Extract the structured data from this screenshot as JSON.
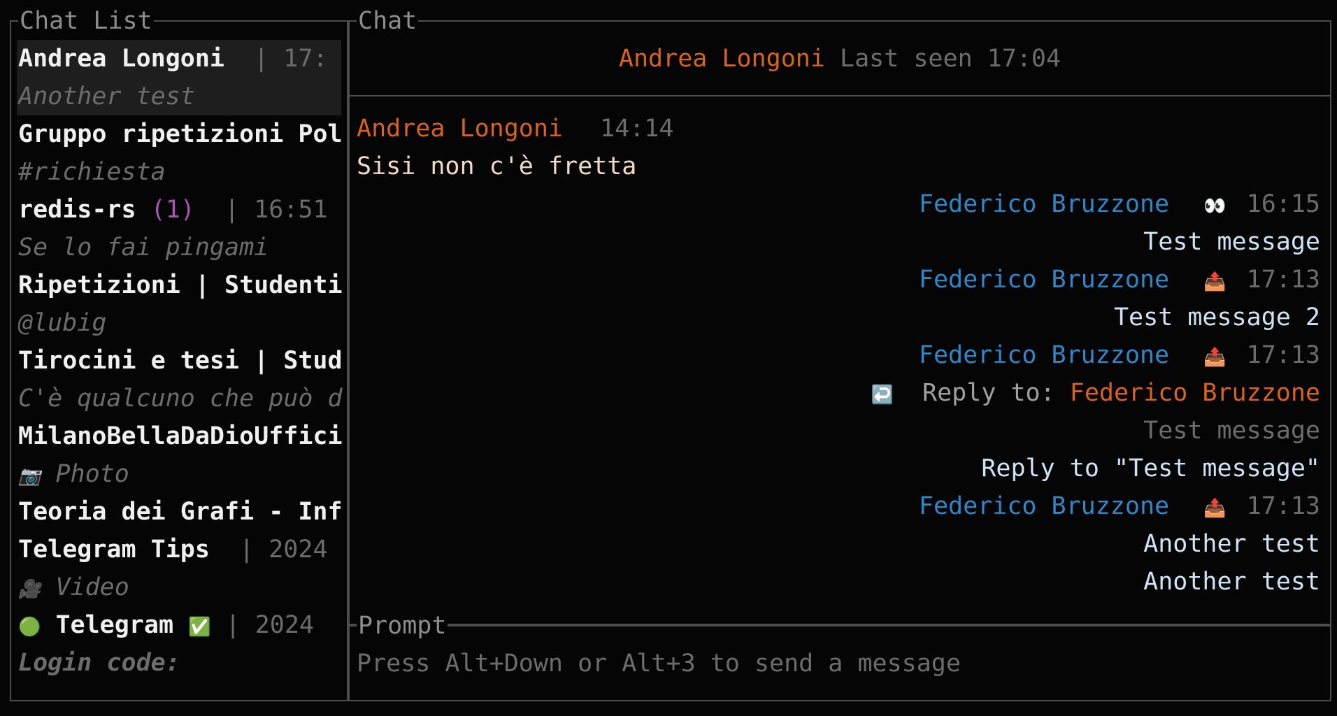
{
  "chat_list": {
    "title": "Chat List",
    "items": [
      {
        "name": "Andrea Longoni",
        "meta": "  | 17:",
        "preview": "Another test"
      },
      {
        "name": "Gruppo ripetizioni Pol",
        "preview": "#richiesta"
      },
      {
        "name": "redis-rs",
        "unread": "(1)",
        "meta": "  | 16:51",
        "preview": "Se lo fai pingami"
      },
      {
        "name": "Ripetizioni | Studenti",
        "preview": "@lubig"
      },
      {
        "name": "Tirocini e tesi | Stud",
        "preview": "C'è qualcuno che può d"
      },
      {
        "name": "MilanoBellaDaDioUffici",
        "preview_icon": "camera-icon",
        "preview": "Photo"
      },
      {
        "name": "Teoria dei Grafi - Inf"
      },
      {
        "name": "Telegram Tips",
        "meta": "  | 2024",
        "preview_icon": "video-camera-icon",
        "preview": "Video"
      },
      {
        "status_icon": "online-dot-icon",
        "name": "Telegram",
        "badge_icon": "verified-check-icon",
        "meta": " | 2024",
        "preview": "Login code:"
      }
    ]
  },
  "chat": {
    "title": "Chat",
    "header": {
      "name": "Andrea Longoni",
      "status": "Last seen 17:04"
    },
    "messages": [
      {
        "side": "left",
        "sender": "Andrea Longoni",
        "time": "14:14",
        "lines": [
          "Sisi non c'è fretta"
        ]
      },
      {
        "side": "right",
        "sender": "Federico Bruzzone",
        "icon": "eyes-icon",
        "time": "16:15",
        "lines": [
          "Test message"
        ]
      },
      {
        "side": "right",
        "sender": "Federico Bruzzone",
        "icon": "outbox-icon",
        "time": "17:13",
        "lines": [
          "Test message 2"
        ]
      },
      {
        "side": "right",
        "sender": "Federico Bruzzone",
        "icon": "outbox-icon",
        "time": "17:13",
        "reply_label": "Reply to:",
        "reply_to": "Federico Bruzzone",
        "reply_quote": "Test message",
        "lines": [
          "Reply to \"Test message\""
        ]
      },
      {
        "side": "right",
        "sender": "Federico Bruzzone",
        "icon": "outbox-icon",
        "time": "17:13",
        "lines": [
          "Another test",
          "Another test"
        ]
      }
    ]
  },
  "prompt": {
    "title": "Prompt",
    "placeholder": "Press Alt+Down or Alt+3 to send a message"
  },
  "colors": {
    "accent_orange": "#d9631b",
    "accent_blue": "#2f86c9",
    "unread_purple": "#a855b4",
    "border": "#4d4d4d",
    "background": "#050505"
  }
}
